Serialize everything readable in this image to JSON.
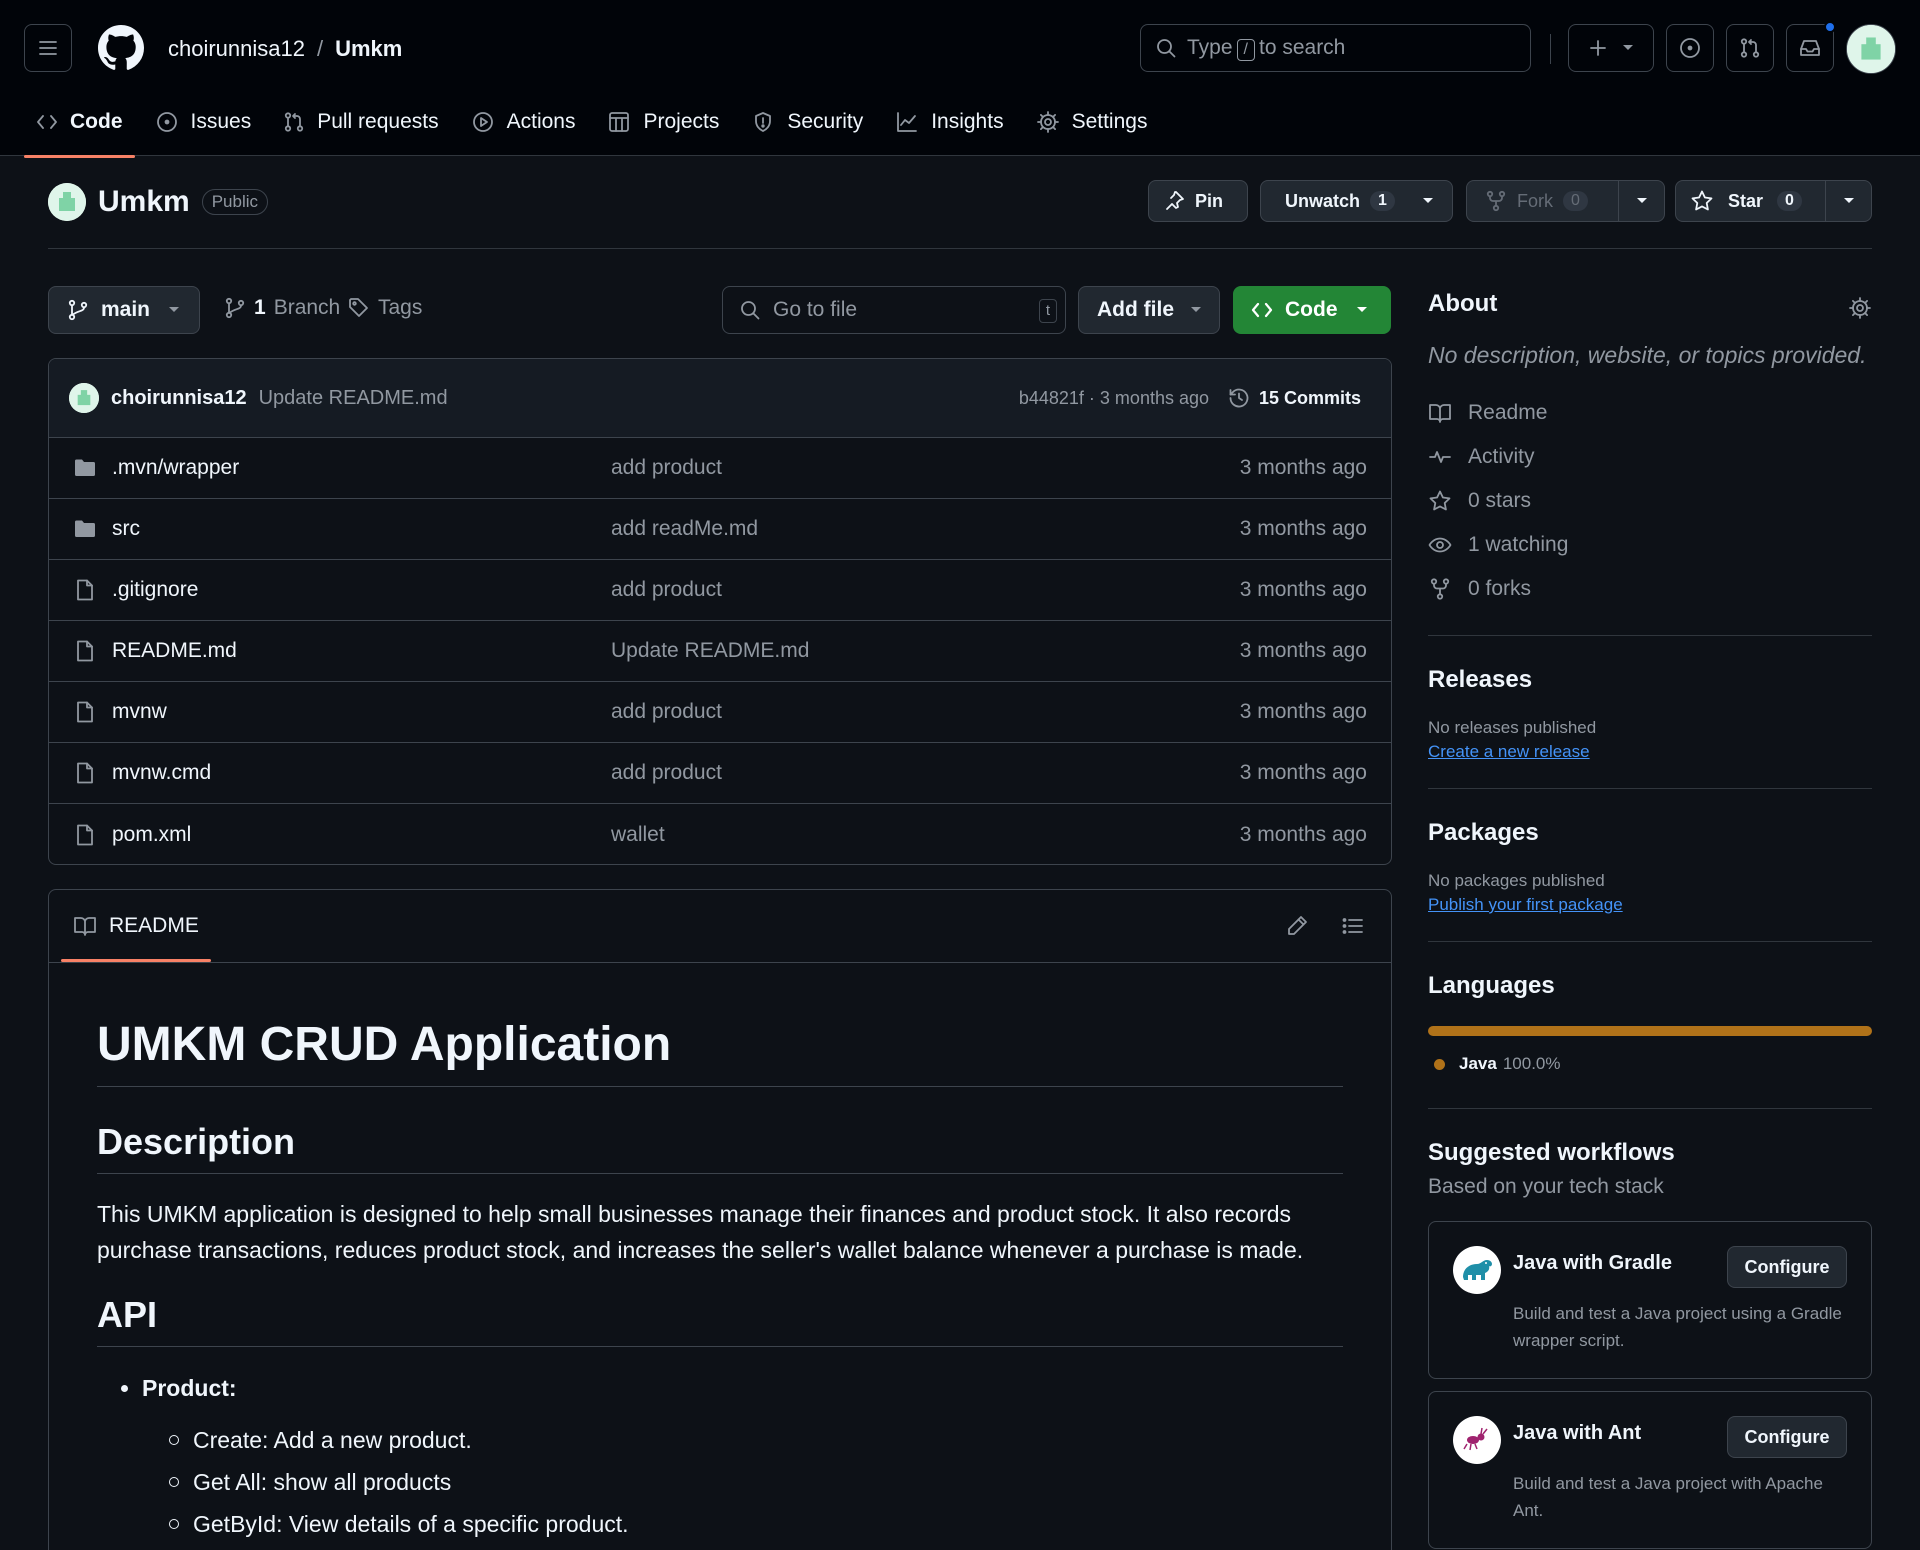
{
  "header": {
    "owner": "choirunnisa12",
    "separator": "/",
    "repo": "Umkm",
    "search": {
      "before": "Type",
      "key": "/",
      "after": "to search"
    }
  },
  "tabs": [
    {
      "label": "Code",
      "icon": "code-icon",
      "active": true
    },
    {
      "label": "Issues",
      "icon": "issue-icon"
    },
    {
      "label": "Pull requests",
      "icon": "pull-request-icon"
    },
    {
      "label": "Actions",
      "icon": "play-icon"
    },
    {
      "label": "Projects",
      "icon": "table-icon"
    },
    {
      "label": "Security",
      "icon": "shield-icon"
    },
    {
      "label": "Insights",
      "icon": "graph-icon"
    },
    {
      "label": "Settings",
      "icon": "gear-icon"
    }
  ],
  "repo": {
    "name": "Umkm",
    "visibility": "Public",
    "actions": {
      "pin": "Pin",
      "unwatch": "Unwatch",
      "watch_count": "1",
      "fork": "Fork",
      "fork_count": "0",
      "star": "Star",
      "star_count": "0"
    }
  },
  "filenav": {
    "branch": "main",
    "branch_count": "1",
    "branch_label": "Branch",
    "tags_label": "Tags",
    "goto_placeholder": "Go to file",
    "goto_key": "t",
    "add_file": "Add file",
    "code": "Code"
  },
  "commit": {
    "user": "choirunnisa12",
    "message": "Update README.md",
    "sha_time": "b44821f · 3 months ago",
    "count": "15 Commits"
  },
  "files": [
    {
      "type": "folder",
      "name": ".mvn/wrapper",
      "message": "add product",
      "age": "3 months ago"
    },
    {
      "type": "folder",
      "name": "src",
      "message": "add readMe.md",
      "age": "3 months ago"
    },
    {
      "type": "file",
      "name": ".gitignore",
      "message": "add product",
      "age": "3 months ago"
    },
    {
      "type": "file",
      "name": "README.md",
      "message": "Update README.md",
      "age": "3 months ago"
    },
    {
      "type": "file",
      "name": "mvnw",
      "message": "add product",
      "age": "3 months ago"
    },
    {
      "type": "file",
      "name": "mvnw.cmd",
      "message": "add product",
      "age": "3 months ago"
    },
    {
      "type": "file",
      "name": "pom.xml",
      "message": "wallet",
      "age": "3 months ago"
    }
  ],
  "readme": {
    "tab": "README",
    "title": "UMKM CRUD Application",
    "h_description": "Description",
    "description": "This UMKM application is designed to help small businesses manage their finances and product stock. It also records purchase transactions, reduces product stock, and increases the seller's wallet balance whenever a purchase is made.",
    "h_api": "API",
    "api_item": "Product:",
    "api_sub": [
      "Create: Add a new product.",
      "Get All: show all products",
      "GetById: View details of a specific product."
    ]
  },
  "sidebar": {
    "about_title": "About",
    "about_desc": "No description, website, or topics provided.",
    "links": [
      {
        "icon": "book-icon",
        "label": "Readme"
      },
      {
        "icon": "pulse-icon",
        "label": "Activity"
      },
      {
        "icon": "star-icon",
        "label": "0 stars"
      },
      {
        "icon": "eye-icon",
        "label": "1 watching"
      },
      {
        "icon": "fork-icon",
        "label": "0 forks"
      }
    ],
    "releases_title": "Releases",
    "releases_text": "No releases published",
    "releases_link": "Create a new release",
    "packages_title": "Packages",
    "packages_text": "No packages published",
    "packages_link": "Publish your first package",
    "languages_title": "Languages",
    "language": {
      "name": "Java",
      "percent": "100.0%",
      "share": 1.0,
      "color": "#b07219"
    },
    "workflows_title": "Suggested workflows",
    "workflows_subtitle": "Based on your tech stack",
    "workflows": [
      {
        "name": "Java with Gradle",
        "desc": "Build and test a Java project using a Gradle wrapper script.",
        "action": "Configure"
      },
      {
        "name": "Java with Ant",
        "desc": "Build and test a Java project with Apache Ant.",
        "action": "Configure"
      }
    ]
  }
}
